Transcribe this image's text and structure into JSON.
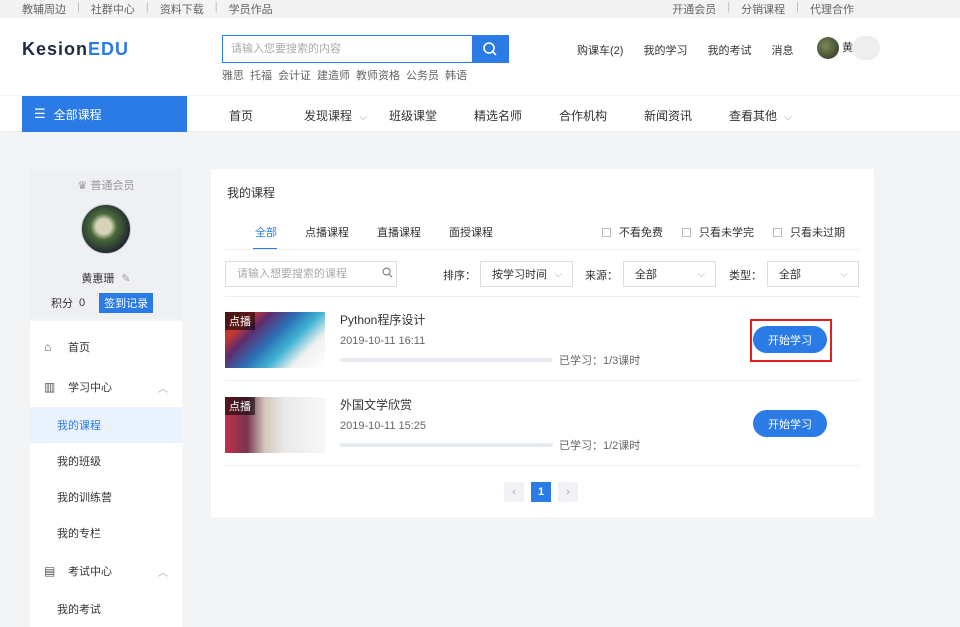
{
  "topbar": {
    "left_links": [
      "教辅周边",
      "社群中心",
      "资料下载",
      "学员作品"
    ],
    "right_links": [
      "开通会员",
      "分销课程",
      "代理合作"
    ]
  },
  "header": {
    "logo_main": "Kesion",
    "logo_accent": "EDU",
    "search_placeholder": "请输入您要搜索的内容",
    "hot_words": [
      "雅思",
      "托福",
      "会计证",
      "建造师",
      "教师资格",
      "公务员",
      "韩语"
    ],
    "user_links": [
      "购课车(2)",
      "我的学习",
      "我的考试",
      "消息"
    ],
    "username": "黄"
  },
  "nav": {
    "all_courses": "全部课程",
    "items": [
      "首页",
      "发现课程",
      "班级课堂",
      "精选名师",
      "合作机构",
      "新闻资讯",
      "查看其他"
    ]
  },
  "profile": {
    "member_level": "普通会员",
    "name": "黄惠珊",
    "points_label": "积分",
    "points_value": "0",
    "sign_button": "签到记录"
  },
  "sidenav": {
    "home": "首页",
    "study_center": "学习中心",
    "my_courses": "我的课程",
    "my_classes": "我的班级",
    "my_training": "我的训练营",
    "my_columns": "我的专栏",
    "exam_center": "考试中心",
    "my_exams": "我的考试"
  },
  "main": {
    "title": "我的课程",
    "tabs": [
      "全部",
      "点播课程",
      "直播课程",
      "面授课程"
    ],
    "checks": [
      "不看免费",
      "只看未学完",
      "只看未过期"
    ],
    "filter_placeholder": "请输入想要搜索的课程",
    "sort_label": "排序：",
    "sort_value": "按学习时间",
    "source_label": "来源：",
    "source_value": "全部",
    "type_label": "类型：",
    "type_value": "全部",
    "courses": [
      {
        "badge": "点播",
        "title": "Python程序设计",
        "date": "2019-10-11 16:11",
        "progress": "已学习：1/3课时",
        "progress_ratio": 0.0,
        "button": "开始学习"
      },
      {
        "badge": "点播",
        "title": "外国文学欣赏",
        "date": "2019-10-11 15:25",
        "progress": "已学习：1/2课时",
        "progress_ratio": 0.0,
        "button": "开始学习"
      }
    ],
    "current_page": "1"
  },
  "colors": {
    "accent": "#2b7be6",
    "highlight": "#e02020"
  }
}
